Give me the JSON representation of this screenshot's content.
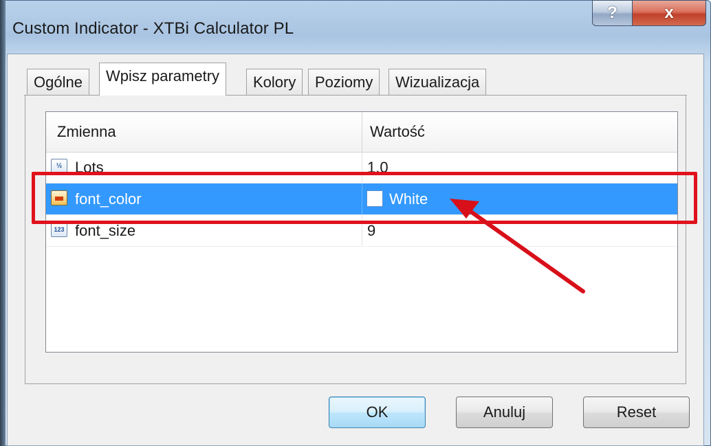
{
  "window": {
    "title": "Custom Indicator - XTBi Calculator PL",
    "help_label": "?",
    "close_label": "x"
  },
  "tabs": [
    {
      "label": "Ogólne",
      "active": false
    },
    {
      "label": "Wpisz parametry",
      "active": true
    },
    {
      "label": "Kolory",
      "active": false
    },
    {
      "label": "Poziomy",
      "active": false
    },
    {
      "label": "Wizualizacja",
      "active": false
    }
  ],
  "grid": {
    "headers": {
      "variable": "Zmienna",
      "value": "Wartość"
    },
    "rows": [
      {
        "name": "Lots",
        "value": "1.0",
        "icon": "fraction-icon",
        "icon_text": "½"
      },
      {
        "name": "font_color",
        "value": "White",
        "icon": "color-icon",
        "selected": true,
        "swatch_color": "#ffffff"
      },
      {
        "name": "font_size",
        "value": "9",
        "icon": "integer-icon",
        "icon_text": "123"
      }
    ]
  },
  "buttons": {
    "ok": "OK",
    "cancel": "Anuluj",
    "reset": "Reset"
  },
  "annotation": {
    "highlight_color": "#e0121c",
    "selection_color": "#3399ff"
  }
}
